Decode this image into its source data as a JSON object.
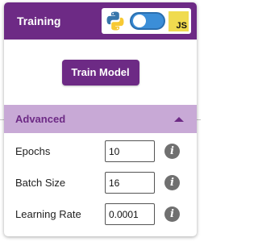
{
  "header": {
    "title": "Training",
    "language_toggle": {
      "left_icon": "python-icon",
      "right_icon": "javascript-icon",
      "right_icon_text": "JS",
      "state": "off"
    }
  },
  "actions": {
    "train_button_label": "Train Model"
  },
  "advanced": {
    "title": "Advanced",
    "expanded": true,
    "icon": "caret-up-icon",
    "params": [
      {
        "label": "Epochs",
        "value": "10",
        "icon": "info-icon",
        "icon_text": "i"
      },
      {
        "label": "Batch Size",
        "value": "16",
        "icon": "info-icon",
        "icon_text": "i"
      },
      {
        "label": "Learning Rate",
        "value": "0.0001",
        "icon": "info-icon",
        "icon_text": "i"
      }
    ]
  },
  "colors": {
    "brand": "#6d2a85",
    "section_header_bg": "#c8a9d6",
    "toggle": "#3b8ed8",
    "js_yellow": "#f0db4f"
  }
}
